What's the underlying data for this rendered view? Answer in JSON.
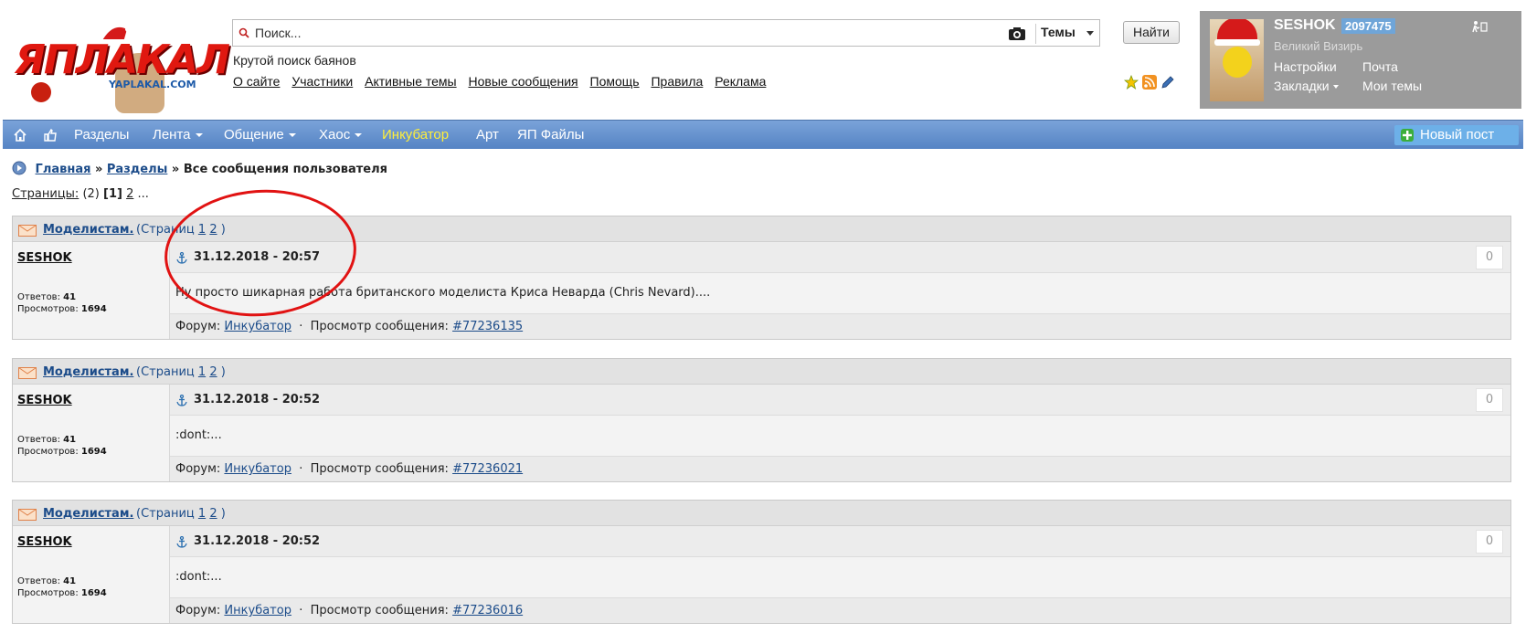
{
  "header": {
    "logo_text": "ЯПЛАКАЛ",
    "logo_sub": "YAPLAKAL.COM",
    "search_placeholder": "Поиск...",
    "search_scope": "Темы",
    "find_button": "Найти",
    "tagline": "Крутой поиск баянов",
    "top_links": [
      "О сайте",
      "Участники",
      "Активные темы",
      "Новые сообщения",
      "Помощь",
      "Правила",
      "Реклама"
    ],
    "mini_icons": [
      "star-icon",
      "rss-icon",
      "pencil-icon"
    ]
  },
  "user": {
    "name": "SESHOK",
    "reputation": "2097475",
    "rank": "Великий Визирь",
    "links": [
      "Настройки",
      "Почта",
      "Закладки",
      "Мои темы"
    ]
  },
  "nav": {
    "items": [
      "Разделы",
      "Лента",
      "Общение",
      "Хаос",
      "Инкубатор",
      "Арт",
      "ЯП Файлы"
    ],
    "new_post": "Новый пост",
    "accent_color": "#ffef3a"
  },
  "breadcrumb": {
    "home": "Главная",
    "sep1": "»",
    "sections": "Разделы",
    "sep2": "»",
    "current": "Все сообщения пользователя"
  },
  "pagination": {
    "label": "Страницы:",
    "total": "(2)",
    "current": "[1]",
    "next": "2",
    "more": "..."
  },
  "posts": [
    {
      "topic": "Моделистам.",
      "pages_open": "(Страниц",
      "page1": "1",
      "page2": "2",
      "pages_close": ")",
      "author": "SESHOK",
      "replies_label": "Ответов:",
      "replies": "41",
      "views_label": "Просмотров:",
      "views": "1694",
      "date": "31.12.2018 - 20:57",
      "rating": "0",
      "body": "Ну просто шикарная работа британского моделиста Криса Неварда (Chris Nevard)....",
      "forum_label": "Форум:",
      "forum": "Инкубатор",
      "dot": "·",
      "view_label": "Просмотр сообщения:",
      "msg_id": "#77236135"
    },
    {
      "topic": "Моделистам.",
      "pages_open": "(Страниц",
      "page1": "1",
      "page2": "2",
      "pages_close": ")",
      "author": "SESHOK",
      "replies_label": "Ответов:",
      "replies": "41",
      "views_label": "Просмотров:",
      "views": "1694",
      "date": "31.12.2018 - 20:52",
      "rating": "0",
      "body": ":dont:...",
      "forum_label": "Форум:",
      "forum": "Инкубатор",
      "dot": "·",
      "view_label": "Просмотр сообщения:",
      "msg_id": "#77236021"
    },
    {
      "topic": "Моделистам.",
      "pages_open": "(Страниц",
      "page1": "1",
      "page2": "2",
      "pages_close": ")",
      "author": "SESHOK",
      "replies_label": "Ответов:",
      "replies": "41",
      "views_label": "Просмотров:",
      "views": "1694",
      "date": "31.12.2018 - 20:52",
      "rating": "0",
      "body": ":dont:...",
      "forum_label": "Форум:",
      "forum": "Инкубатор",
      "dot": "·",
      "view_label": "Просмотр сообщения:",
      "msg_id": "#77236016"
    }
  ]
}
